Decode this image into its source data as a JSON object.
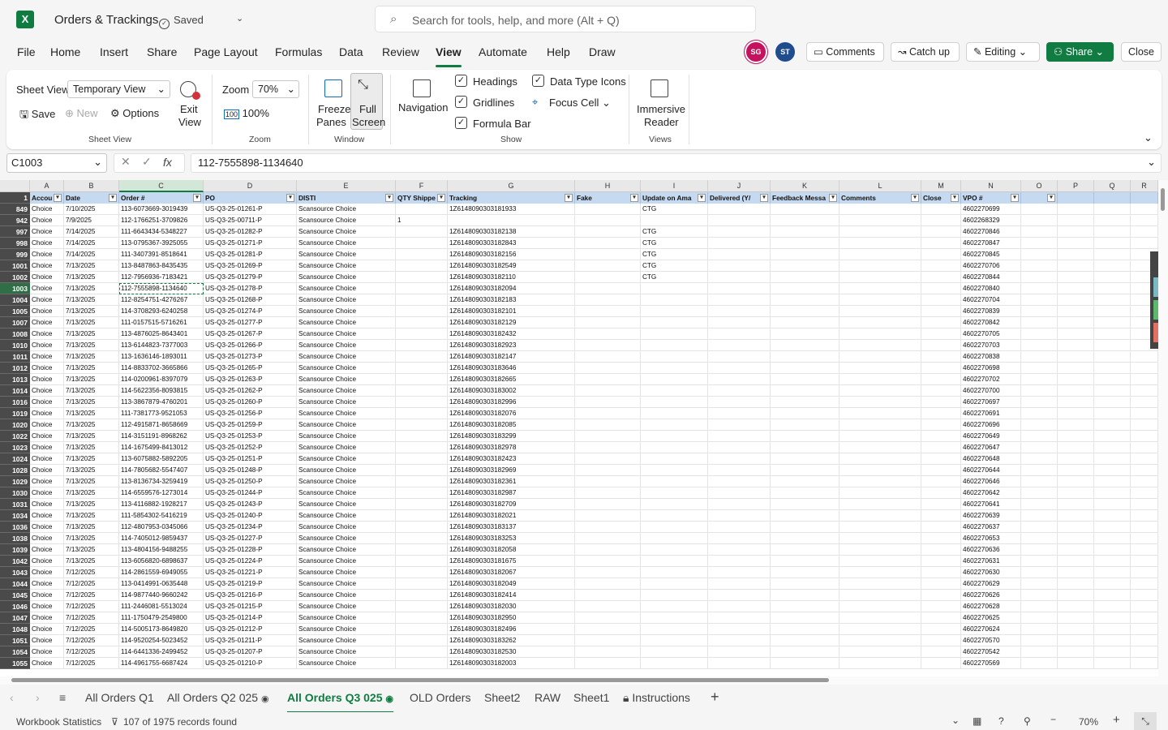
{
  "app": {
    "title": "Orders & Trackings",
    "save_state": "Saved",
    "search_placeholder": "Search for tools, help, and more (Alt + Q)"
  },
  "menu": [
    "File",
    "Home",
    "Insert",
    "Share",
    "Page Layout",
    "Formulas",
    "Data",
    "Review",
    "View",
    "Automate",
    "Help",
    "Draw"
  ],
  "menu_active": "View",
  "header_buttons": {
    "avatar1": "SG",
    "avatar2": "ST",
    "comments": "Comments",
    "catchup": "Catch up",
    "editing": "Editing",
    "share": "Share",
    "close": "Close"
  },
  "ribbon": {
    "sheet_view_label": "Sheet View",
    "sheet_view_value": "Temporary View",
    "save": "Save",
    "new": "New",
    "options": "Options",
    "exit_view_1": "Exit",
    "exit_view_2": "View",
    "group_sheet_view": "Sheet View",
    "zoom_label": "Zoom",
    "zoom_value": "70%",
    "zoom_100": "100%",
    "group_zoom": "Zoom",
    "freeze_1": "Freeze",
    "freeze_2": "Panes",
    "full_1": "Full",
    "full_2": "Screen",
    "group_window": "Window",
    "navigation": "Navigation",
    "headings": "Headings",
    "gridlines": "Gridlines",
    "formula_bar": "Formula Bar",
    "data_type_icons": "Data Type Icons",
    "focus_cell": "Focus Cell",
    "group_show": "Show",
    "immersive_1": "Immersive",
    "immersive_2": "Reader",
    "group_views": "Views"
  },
  "formula_bar": {
    "name_box": "C1003",
    "formula": "112-7555898-1134640"
  },
  "columns": [
    "A",
    "B",
    "C",
    "D",
    "E",
    "F",
    "G",
    "H",
    "I",
    "J",
    "K",
    "L",
    "M",
    "N",
    "O",
    "P",
    "Q",
    "R"
  ],
  "headers": [
    "Accou",
    "Date",
    "Order #",
    "PO",
    "DISTI",
    "QTY Shippe",
    "Tracking",
    "Fake",
    "Update on Ama",
    "Delivered (Y/",
    "Feedback Messa",
    "Comments",
    "Close",
    "VPO #",
    "",
    "",
    "",
    ""
  ],
  "rows": [
    {
      "n": "849",
      "date": "7/10/2025",
      "order": "113-6073669-3019439",
      "po": "US-Q3-25-01261-P",
      "qty": "",
      "tracking": "1Z6148090303181933",
      "update": "CTG",
      "vpo": "4602270699"
    },
    {
      "n": "942",
      "date": "7/9/2025",
      "order": "112-1766251-3709826",
      "po": "US-Q3-25-00711-P",
      "qty": "1",
      "tracking": "",
      "update": "",
      "vpo": "4602268329"
    },
    {
      "n": "997",
      "date": "7/14/2025",
      "order": "111-6643434-5348227",
      "po": "US-Q3-25-01282-P",
      "qty": "",
      "tracking": "1Z6148090303182138",
      "update": "CTG",
      "vpo": "4602270846"
    },
    {
      "n": "998",
      "date": "7/14/2025",
      "order": "113-0795367-3925055",
      "po": "US-Q3-25-01271-P",
      "qty": "",
      "tracking": "1Z6148090303182843",
      "update": "CTG",
      "vpo": "4602270847"
    },
    {
      "n": "999",
      "date": "7/14/2025",
      "order": "111-3407391-8518641",
      "po": "US-Q3-25-01281-P",
      "qty": "",
      "tracking": "1Z6148090303182156",
      "update": "CTG",
      "vpo": "4602270845"
    },
    {
      "n": "1001",
      "date": "7/13/2025",
      "order": "113-8487863-8435435",
      "po": "US-Q3-25-01269-P",
      "qty": "",
      "tracking": "1Z6148090303182549",
      "update": "CTG",
      "vpo": "4602270706"
    },
    {
      "n": "1002",
      "date": "7/13/2025",
      "order": "112-7956936-7183421",
      "po": "US-Q3-25-01279-P",
      "qty": "",
      "tracking": "1Z6148090303182110",
      "update": "CTG",
      "vpo": "4602270844"
    },
    {
      "n": "1003",
      "date": "7/13/2025",
      "order": "112-7555898-1134640",
      "po": "US-Q3-25-01278-P",
      "qty": "",
      "tracking": "1Z6148090303182094",
      "update": "",
      "vpo": "4602270840"
    },
    {
      "n": "1004",
      "date": "7/13/2025",
      "order": "112-8254751-4276267",
      "po": "US-Q3-25-01268-P",
      "qty": "",
      "tracking": "1Z6148090303182183",
      "update": "",
      "vpo": "4602270704"
    },
    {
      "n": "1005",
      "date": "7/13/2025",
      "order": "114-3708293-6240258",
      "po": "US-Q3-25-01274-P",
      "qty": "",
      "tracking": "1Z6148090303182101",
      "update": "",
      "vpo": "4602270839"
    },
    {
      "n": "1007",
      "date": "7/13/2025",
      "order": "111-0157515-5716261",
      "po": "US-Q3-25-01277-P",
      "qty": "",
      "tracking": "1Z6148090303182129",
      "update": "",
      "vpo": "4602270842"
    },
    {
      "n": "1008",
      "date": "7/13/2025",
      "order": "113-4876025-8643401",
      "po": "US-Q3-25-01267-P",
      "qty": "",
      "tracking": "1Z6148090303182432",
      "update": "",
      "vpo": "4602270705"
    },
    {
      "n": "1010",
      "date": "7/13/2025",
      "order": "113-6144823-7377003",
      "po": "US-Q3-25-01266-P",
      "qty": "",
      "tracking": "1Z6148090303182923",
      "update": "",
      "vpo": "4602270703"
    },
    {
      "n": "1011",
      "date": "7/13/2025",
      "order": "113-1636146-1893011",
      "po": "US-Q3-25-01273-P",
      "qty": "",
      "tracking": "1Z6148090303182147",
      "update": "",
      "vpo": "4602270838"
    },
    {
      "n": "1012",
      "date": "7/13/2025",
      "order": "114-8833702-3665866",
      "po": "US-Q3-25-01265-P",
      "qty": "",
      "tracking": "1Z6148090303183646",
      "update": "",
      "vpo": "4602270698"
    },
    {
      "n": "1013",
      "date": "7/13/2025",
      "order": "114-0200961-8397079",
      "po": "US-Q3-25-01263-P",
      "qty": "",
      "tracking": "1Z6148090303182665",
      "update": "",
      "vpo": "4602270702"
    },
    {
      "n": "1014",
      "date": "7/13/2025",
      "order": "114-5622356-8093815",
      "po": "US-Q3-25-01262-P",
      "qty": "",
      "tracking": "1Z6148090303183002",
      "update": "",
      "vpo": "4602270700"
    },
    {
      "n": "1016",
      "date": "7/13/2025",
      "order": "113-3867879-4760201",
      "po": "US-Q3-25-01260-P",
      "qty": "",
      "tracking": "1Z6148090303182996",
      "update": "",
      "vpo": "4602270697"
    },
    {
      "n": "1019",
      "date": "7/13/2025",
      "order": "111-7381773-9521053",
      "po": "US-Q3-25-01256-P",
      "qty": "",
      "tracking": "1Z6148090303182076",
      "update": "",
      "vpo": "4602270691"
    },
    {
      "n": "1020",
      "date": "7/13/2025",
      "order": "112-4915871-8658669",
      "po": "US-Q3-25-01259-P",
      "qty": "",
      "tracking": "1Z6148090303182085",
      "update": "",
      "vpo": "4602270696"
    },
    {
      "n": "1022",
      "date": "7/13/2025",
      "order": "114-3151191-8968262",
      "po": "US-Q3-25-01253-P",
      "qty": "",
      "tracking": "1Z6148090303183299",
      "update": "",
      "vpo": "4602270649"
    },
    {
      "n": "1023",
      "date": "7/13/2025",
      "order": "114-1675499-8413012",
      "po": "US-Q3-25-01252-P",
      "qty": "",
      "tracking": "1Z6148090303182978",
      "update": "",
      "vpo": "4602270647"
    },
    {
      "n": "1024",
      "date": "7/13/2025",
      "order": "113-6075882-5892205",
      "po": "US-Q3-25-01251-P",
      "qty": "",
      "tracking": "1Z6148090303182423",
      "update": "",
      "vpo": "4602270648"
    },
    {
      "n": "1028",
      "date": "7/13/2025",
      "order": "114-7805682-5547407",
      "po": "US-Q3-25-01248-P",
      "qty": "",
      "tracking": "1Z6148090303182969",
      "update": "",
      "vpo": "4602270644"
    },
    {
      "n": "1029",
      "date": "7/13/2025",
      "order": "113-8136734-3259419",
      "po": "US-Q3-25-01250-P",
      "qty": "",
      "tracking": "1Z6148090303182361",
      "update": "",
      "vpo": "4602270646"
    },
    {
      "n": "1030",
      "date": "7/13/2025",
      "order": "114-6559576-1273014",
      "po": "US-Q3-25-01244-P",
      "qty": "",
      "tracking": "1Z6148090303182987",
      "update": "",
      "vpo": "4602270642"
    },
    {
      "n": "1031",
      "date": "7/13/2025",
      "order": "113-4116882-1928217",
      "po": "US-Q3-25-01243-P",
      "qty": "",
      "tracking": "1Z6148090303182709",
      "update": "",
      "vpo": "4602270641"
    },
    {
      "n": "1034",
      "date": "7/13/2025",
      "order": "111-5854302-5416219",
      "po": "US-Q3-25-01240-P",
      "qty": "",
      "tracking": "1Z6148090303182021",
      "update": "",
      "vpo": "4602270639"
    },
    {
      "n": "1036",
      "date": "7/13/2025",
      "order": "112-4807953-0345066",
      "po": "US-Q3-25-01234-P",
      "qty": "",
      "tracking": "1Z6148090303183137",
      "update": "",
      "vpo": "4602270637"
    },
    {
      "n": "1038",
      "date": "7/13/2025",
      "order": "114-7405012-9859437",
      "po": "US-Q3-25-01227-P",
      "qty": "",
      "tracking": "1Z6148090303183253",
      "update": "",
      "vpo": "4602270653"
    },
    {
      "n": "1039",
      "date": "7/13/2025",
      "order": "113-4804156-9488255",
      "po": "US-Q3-25-01228-P",
      "qty": "",
      "tracking": "1Z6148090303182058",
      "update": "",
      "vpo": "4602270636"
    },
    {
      "n": "1042",
      "date": "7/13/2025",
      "order": "113-6056820-6898637",
      "po": "US-Q3-25-01224-P",
      "qty": "",
      "tracking": "1Z6148090303181675",
      "update": "",
      "vpo": "4602270631"
    },
    {
      "n": "1043",
      "date": "7/12/2025",
      "order": "114-2861559-6949055",
      "po": "US-Q3-25-01221-P",
      "qty": "",
      "tracking": "1Z6148090303182067",
      "update": "",
      "vpo": "4602270630"
    },
    {
      "n": "1044",
      "date": "7/12/2025",
      "order": "113-0414991-0635448",
      "po": "US-Q3-25-01219-P",
      "qty": "",
      "tracking": "1Z6148090303182049",
      "update": "",
      "vpo": "4602270629"
    },
    {
      "n": "1045",
      "date": "7/12/2025",
      "order": "114-9877440-9660242",
      "po": "US-Q3-25-01216-P",
      "qty": "",
      "tracking": "1Z6148090303182414",
      "update": "",
      "vpo": "4602270626"
    },
    {
      "n": "1046",
      "date": "7/12/2025",
      "order": "111-2446081-5513024",
      "po": "US-Q3-25-01215-P",
      "qty": "",
      "tracking": "1Z6148090303182030",
      "update": "",
      "vpo": "4602270628"
    },
    {
      "n": "1047",
      "date": "7/12/2025",
      "order": "111-1750479-2549800",
      "po": "US-Q3-25-01214-P",
      "qty": "",
      "tracking": "1Z6148090303182950",
      "update": "",
      "vpo": "4602270625"
    },
    {
      "n": "1048",
      "date": "7/12/2025",
      "order": "114-5005173-8649820",
      "po": "US-Q3-25-01212-P",
      "qty": "",
      "tracking": "1Z6148090303182496",
      "update": "",
      "vpo": "4602270624"
    },
    {
      "n": "1051",
      "date": "7/12/2025",
      "order": "114-9520254-5023452",
      "po": "US-Q3-25-01211-P",
      "qty": "",
      "tracking": "1Z6148090303183262",
      "update": "",
      "vpo": "4602270570"
    },
    {
      "n": "1054",
      "date": "7/12/2025",
      "order": "114-6441336-2499452",
      "po": "US-Q3-25-01207-P",
      "qty": "",
      "tracking": "1Z6148090303182530",
      "update": "",
      "vpo": "4602270542"
    },
    {
      "n": "1055",
      "date": "7/12/2025",
      "order": "114-4961755-6687424",
      "po": "US-Q3-25-01210-P",
      "qty": "",
      "tracking": "1Z6148090303182003",
      "update": "",
      "vpo": "4602270569"
    }
  ],
  "row_constants": {
    "account": "Choice",
    "disti": "Scansource Choice"
  },
  "active_cell_row": "1003",
  "sheet_tabs": [
    "All Orders Q1",
    "All Orders Q2 025",
    "All Orders Q3 025",
    "OLD Orders",
    "Sheet2",
    "RAW",
    "Sheet1",
    "Instructions"
  ],
  "active_tab": "All Orders Q3 025",
  "status": {
    "workbook_stats": "Workbook Statistics",
    "records": "107 of 1975 records found",
    "zoom": "70%"
  },
  "colors": {
    "accent": "#107c41",
    "header_fill": "#c5daf0",
    "row_header": "#4a4a4a"
  }
}
